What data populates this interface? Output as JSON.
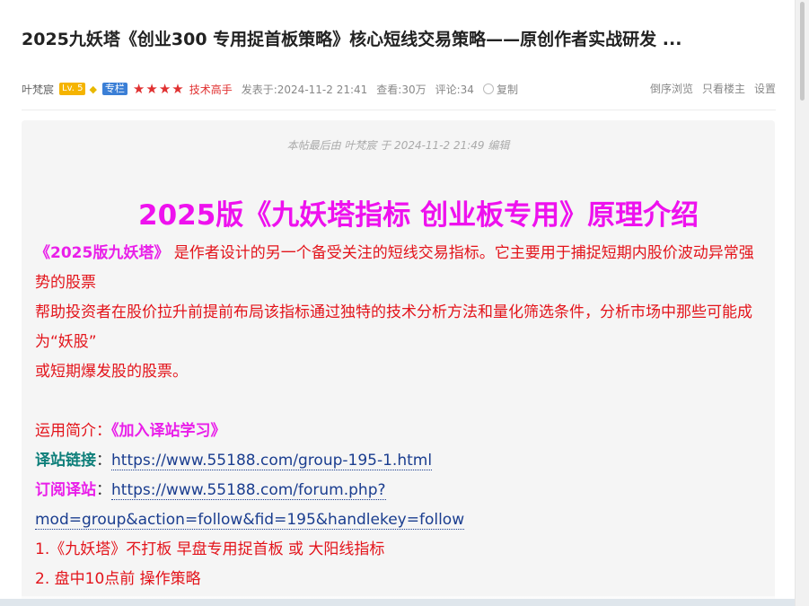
{
  "post": {
    "title": "2025九妖塔《创业300 专用捉首板策略》核心短线交易策略——原创作者实战研发 ...",
    "meta": {
      "author": "叶梵宸",
      "level": "Lv. 5",
      "column_badge": "专栏",
      "stars": "★★★★",
      "rank": "技术高手",
      "posted": "发表于:2024-11-2 21:41",
      "views": "查看:30万",
      "comments": "评论:34",
      "copy": "复制",
      "reverse_view": "倒序浏览",
      "owner_only": "只看楼主",
      "settings": "设置"
    },
    "edit_note": "本帖最后由 叶梵宸 于 2024-11-2 21:49 编辑",
    "heading": "2025版《九妖塔指标 创业板专用》原理介绍",
    "intro_highlight": "《2025版九妖塔》",
    "intro_rest": " 是作者设计的另一个备受关注的短线交易指标。它主要用于捕捉短期内股价波动异常强势的股票",
    "line2": "帮助投资者在股价拉升前提前布局该指标通过独特的技术分析方法和量化筛选条件，分析市场中那些可能成为“妖股”",
    "line3": "或短期爆发股的股票。",
    "usage_label": "运用简介：",
    "usage_link": "《加入译站学习》",
    "station_label": "译站链接",
    "station_url": "https://www.55188.com/group-195-1.html",
    "subscribe_label": "订阅译站",
    "subscribe_url": "https://www.55188.com/forum.php?mod=group&action=follow&fid=195&handlekey=follow",
    "item1": "1.《九妖塔》不打板 早盘专用捉首板 或 大阳线指标",
    "item2": "2. 盘中10点前 操作策略",
    "separator": "："
  },
  "colors": {
    "heading": "#ee11ee",
    "body_red": "#e3141b",
    "label_teal": "#0e7f7a",
    "link": "#1a3d8f"
  }
}
